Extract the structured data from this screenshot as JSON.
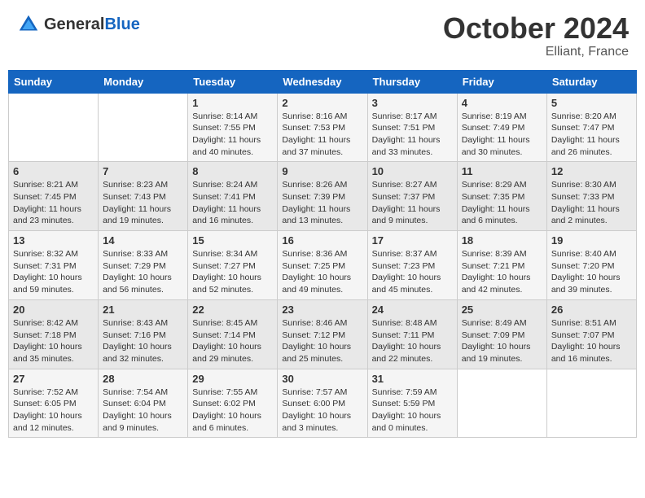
{
  "header": {
    "logo_general": "General",
    "logo_blue": "Blue",
    "month_year": "October 2024",
    "location": "Elliant, France"
  },
  "days_of_week": [
    "Sunday",
    "Monday",
    "Tuesday",
    "Wednesday",
    "Thursday",
    "Friday",
    "Saturday"
  ],
  "weeks": [
    [
      {
        "day": "",
        "detail": ""
      },
      {
        "day": "",
        "detail": ""
      },
      {
        "day": "1",
        "detail": "Sunrise: 8:14 AM\nSunset: 7:55 PM\nDaylight: 11 hours and 40 minutes."
      },
      {
        "day": "2",
        "detail": "Sunrise: 8:16 AM\nSunset: 7:53 PM\nDaylight: 11 hours and 37 minutes."
      },
      {
        "day": "3",
        "detail": "Sunrise: 8:17 AM\nSunset: 7:51 PM\nDaylight: 11 hours and 33 minutes."
      },
      {
        "day": "4",
        "detail": "Sunrise: 8:19 AM\nSunset: 7:49 PM\nDaylight: 11 hours and 30 minutes."
      },
      {
        "day": "5",
        "detail": "Sunrise: 8:20 AM\nSunset: 7:47 PM\nDaylight: 11 hours and 26 minutes."
      }
    ],
    [
      {
        "day": "6",
        "detail": "Sunrise: 8:21 AM\nSunset: 7:45 PM\nDaylight: 11 hours and 23 minutes."
      },
      {
        "day": "7",
        "detail": "Sunrise: 8:23 AM\nSunset: 7:43 PM\nDaylight: 11 hours and 19 minutes."
      },
      {
        "day": "8",
        "detail": "Sunrise: 8:24 AM\nSunset: 7:41 PM\nDaylight: 11 hours and 16 minutes."
      },
      {
        "day": "9",
        "detail": "Sunrise: 8:26 AM\nSunset: 7:39 PM\nDaylight: 11 hours and 13 minutes."
      },
      {
        "day": "10",
        "detail": "Sunrise: 8:27 AM\nSunset: 7:37 PM\nDaylight: 11 hours and 9 minutes."
      },
      {
        "day": "11",
        "detail": "Sunrise: 8:29 AM\nSunset: 7:35 PM\nDaylight: 11 hours and 6 minutes."
      },
      {
        "day": "12",
        "detail": "Sunrise: 8:30 AM\nSunset: 7:33 PM\nDaylight: 11 hours and 2 minutes."
      }
    ],
    [
      {
        "day": "13",
        "detail": "Sunrise: 8:32 AM\nSunset: 7:31 PM\nDaylight: 10 hours and 59 minutes."
      },
      {
        "day": "14",
        "detail": "Sunrise: 8:33 AM\nSunset: 7:29 PM\nDaylight: 10 hours and 56 minutes."
      },
      {
        "day": "15",
        "detail": "Sunrise: 8:34 AM\nSunset: 7:27 PM\nDaylight: 10 hours and 52 minutes."
      },
      {
        "day": "16",
        "detail": "Sunrise: 8:36 AM\nSunset: 7:25 PM\nDaylight: 10 hours and 49 minutes."
      },
      {
        "day": "17",
        "detail": "Sunrise: 8:37 AM\nSunset: 7:23 PM\nDaylight: 10 hours and 45 minutes."
      },
      {
        "day": "18",
        "detail": "Sunrise: 8:39 AM\nSunset: 7:21 PM\nDaylight: 10 hours and 42 minutes."
      },
      {
        "day": "19",
        "detail": "Sunrise: 8:40 AM\nSunset: 7:20 PM\nDaylight: 10 hours and 39 minutes."
      }
    ],
    [
      {
        "day": "20",
        "detail": "Sunrise: 8:42 AM\nSunset: 7:18 PM\nDaylight: 10 hours and 35 minutes."
      },
      {
        "day": "21",
        "detail": "Sunrise: 8:43 AM\nSunset: 7:16 PM\nDaylight: 10 hours and 32 minutes."
      },
      {
        "day": "22",
        "detail": "Sunrise: 8:45 AM\nSunset: 7:14 PM\nDaylight: 10 hours and 29 minutes."
      },
      {
        "day": "23",
        "detail": "Sunrise: 8:46 AM\nSunset: 7:12 PM\nDaylight: 10 hours and 25 minutes."
      },
      {
        "day": "24",
        "detail": "Sunrise: 8:48 AM\nSunset: 7:11 PM\nDaylight: 10 hours and 22 minutes."
      },
      {
        "day": "25",
        "detail": "Sunrise: 8:49 AM\nSunset: 7:09 PM\nDaylight: 10 hours and 19 minutes."
      },
      {
        "day": "26",
        "detail": "Sunrise: 8:51 AM\nSunset: 7:07 PM\nDaylight: 10 hours and 16 minutes."
      }
    ],
    [
      {
        "day": "27",
        "detail": "Sunrise: 7:52 AM\nSunset: 6:05 PM\nDaylight: 10 hours and 12 minutes."
      },
      {
        "day": "28",
        "detail": "Sunrise: 7:54 AM\nSunset: 6:04 PM\nDaylight: 10 hours and 9 minutes."
      },
      {
        "day": "29",
        "detail": "Sunrise: 7:55 AM\nSunset: 6:02 PM\nDaylight: 10 hours and 6 minutes."
      },
      {
        "day": "30",
        "detail": "Sunrise: 7:57 AM\nSunset: 6:00 PM\nDaylight: 10 hours and 3 minutes."
      },
      {
        "day": "31",
        "detail": "Sunrise: 7:59 AM\nSunset: 5:59 PM\nDaylight: 10 hours and 0 minutes."
      },
      {
        "day": "",
        "detail": ""
      },
      {
        "day": "",
        "detail": ""
      }
    ]
  ]
}
